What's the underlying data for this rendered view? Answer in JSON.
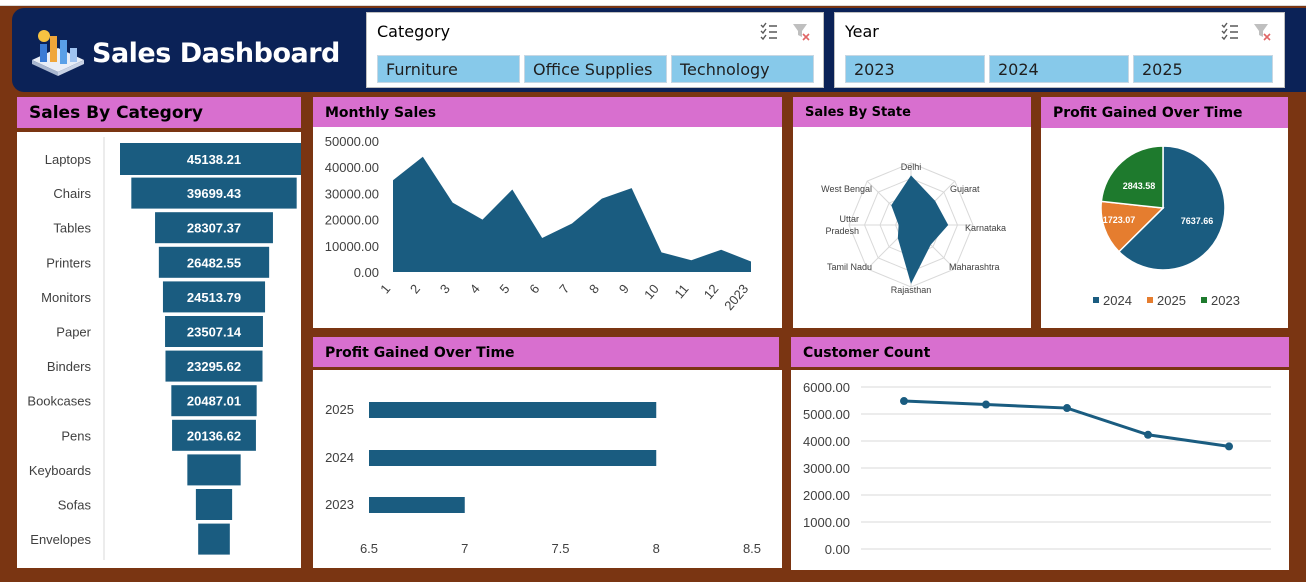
{
  "dashboard": {
    "title": "Sales Dashboard"
  },
  "slicers": {
    "category": {
      "title": "Category",
      "items": [
        "Furniture",
        "Office Supplies",
        "Technology"
      ]
    },
    "year": {
      "title": "Year",
      "items": [
        "2023",
        "2024",
        "2025"
      ]
    }
  },
  "panels": {
    "sales_by_category": {
      "title": "Sales By Category"
    },
    "monthly_sales": {
      "title": "Monthly Sales"
    },
    "sales_by_state": {
      "title": "Sales By State"
    },
    "profit_pie": {
      "title": "Profit Gained Over Time"
    },
    "profit_bar": {
      "title": "Profit Gained Over Time"
    },
    "customer_count": {
      "title": "Customer Count"
    }
  },
  "colors": {
    "header": "#0b2257",
    "panel_header": "#d86fcf",
    "primary": "#1a5c80",
    "orange": "#e57d2f",
    "green": "#1e7a2d",
    "slicer_item": "#87c9ea",
    "background": "#7a3512"
  },
  "chart_data": [
    {
      "id": "sales_by_category",
      "type": "bar",
      "categories": [
        "Laptops",
        "Chairs",
        "Tables",
        "Printers",
        "Monitors",
        "Paper",
        "Binders",
        "Bookcases",
        "Pens",
        "Keyboards",
        "Sofas",
        "Envelopes"
      ],
      "values": [
        45138.21,
        39699.43,
        28307.37,
        26482.55,
        24513.79,
        23507.14,
        23295.62,
        20487.01,
        20136.62,
        12800,
        8700,
        7600
      ],
      "labels": [
        "45138.21",
        "39699.43",
        "28307.37",
        "26482.55",
        "24513.79",
        "23507.14",
        "23295.62",
        "20487.01",
        "20136.62",
        "",
        "",
        ""
      ]
    },
    {
      "id": "monthly_sales",
      "type": "area",
      "x": [
        "1",
        "2",
        "3",
        "4",
        "5",
        "6",
        "7",
        "8",
        "9",
        "10",
        "11",
        "12",
        "2023"
      ],
      "values": [
        35000,
        44000,
        26500,
        20000,
        31500,
        13000,
        18500,
        28000,
        32000,
        7500,
        4500,
        8500,
        4000
      ],
      "yticks": [
        "50000.00",
        "40000.00",
        "30000.00",
        "20000.00",
        "10000.00",
        "0.00"
      ],
      "ylim": [
        0,
        50000
      ]
    },
    {
      "id": "sales_by_state",
      "type": "radar",
      "categories": [
        "Delhi",
        "Gujarat",
        "Karnataka",
        "Maharashtra",
        "Rajasthan",
        "Tamil Nadu",
        "Uttar Pradesh",
        "West Bengal"
      ],
      "values": [
        0.8,
        0.55,
        0.6,
        0.45,
        0.95,
        0.3,
        0.2,
        0.45
      ]
    },
    {
      "id": "profit_pie",
      "type": "pie",
      "series": [
        {
          "name": "2024",
          "value": 7637.66,
          "label": "7637.66"
        },
        {
          "name": "2025",
          "value": 1723.07,
          "label": "1723.07"
        },
        {
          "name": "2023",
          "value": 2843.58,
          "label": "2843.58"
        }
      ]
    },
    {
      "id": "profit_bar",
      "type": "bar",
      "categories": [
        "2025",
        "2024",
        "2023"
      ],
      "values": [
        8,
        8,
        7
      ],
      "xticks": [
        "6.5",
        "7",
        "7.5",
        "8",
        "8.5"
      ],
      "xlim": [
        6.5,
        8.5
      ]
    },
    {
      "id": "customer_count",
      "type": "line",
      "values": [
        5480,
        5350,
        5220,
        4230,
        3800
      ],
      "yticks": [
        "6000.00",
        "5000.00",
        "4000.00",
        "3000.00",
        "2000.00",
        "1000.00",
        "0.00"
      ],
      "ylim": [
        0,
        6000
      ]
    }
  ]
}
